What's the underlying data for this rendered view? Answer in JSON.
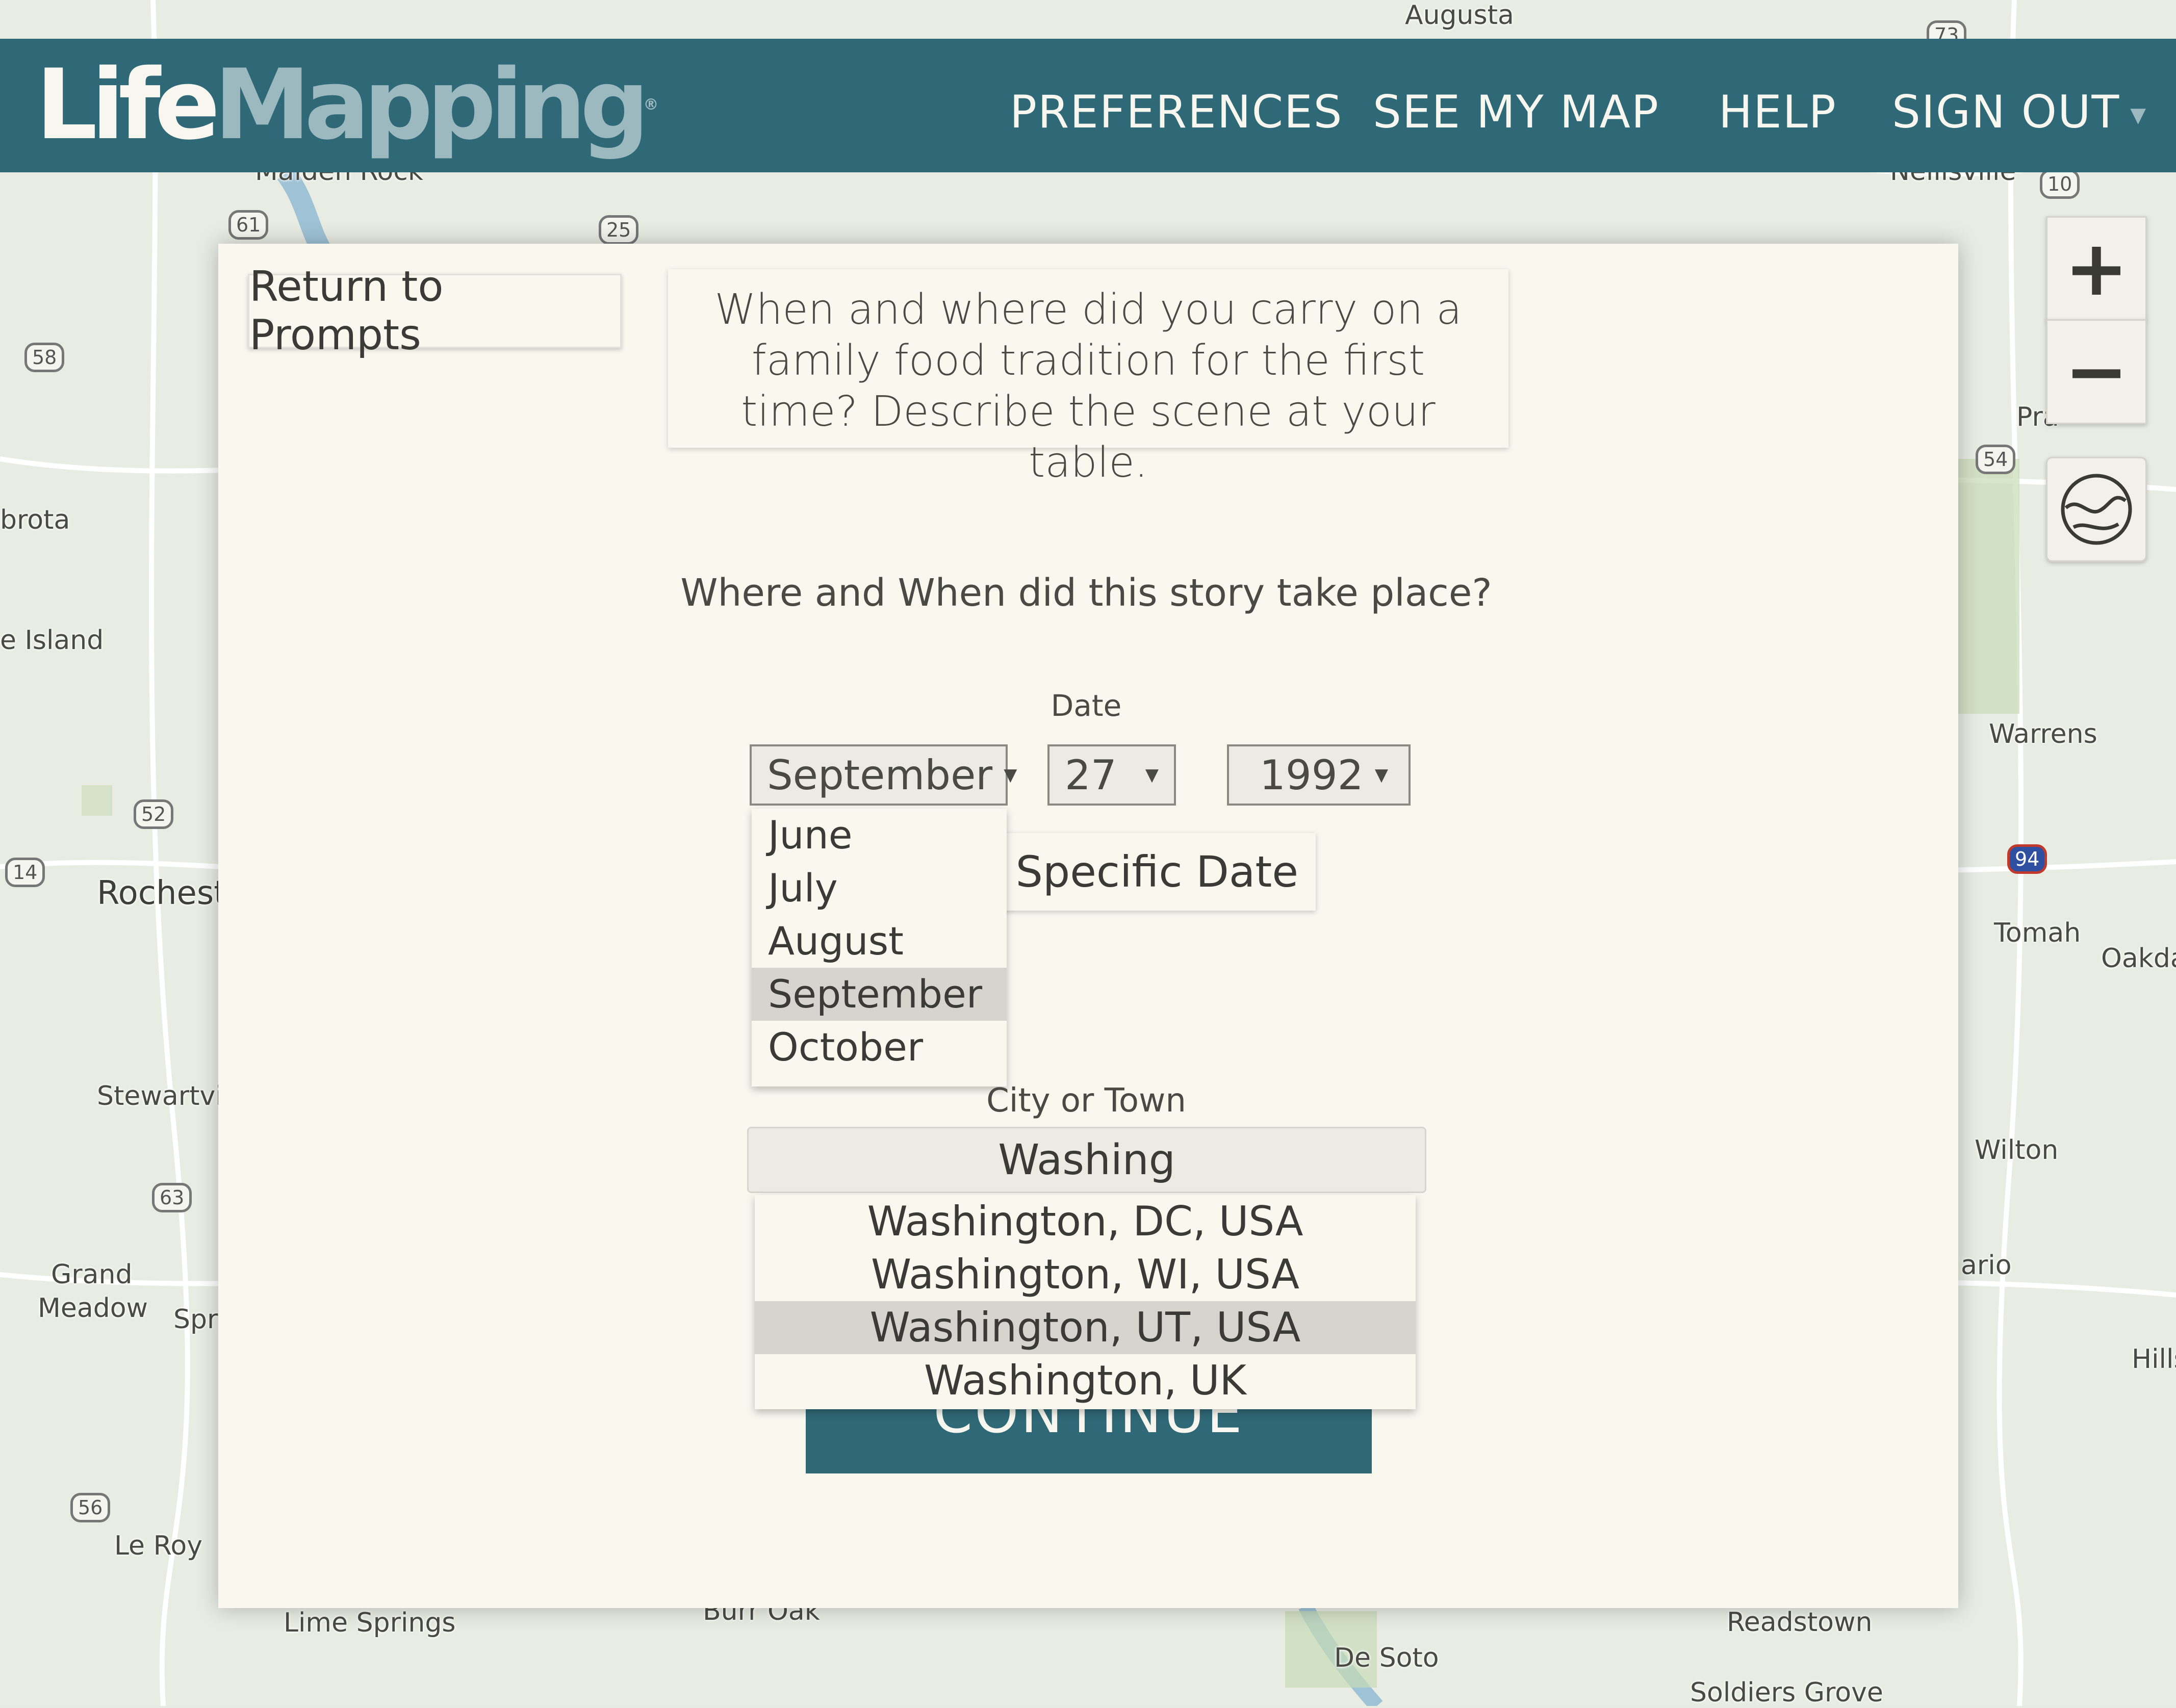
{
  "app": {
    "logo_life": "Life",
    "logo_mapping": "Mapping",
    "logo_mark": "®",
    "brand_color": "#2f6876"
  },
  "nav": {
    "preferences": "PREFERENCES",
    "see_my_map": "SEE MY MAP",
    "help": "HELP",
    "sign_out": "SIGN OUT"
  },
  "map": {
    "labels": [
      "Augusta",
      "Rochest",
      "Stewartvil",
      "Grand",
      "Meadow",
      "Spr",
      "Le Roy",
      "Lime Springs",
      "Burr Oak",
      "De Soto",
      "Readstown",
      "Soldiers Grove",
      "Warrens",
      "Tomah",
      "Oakda",
      "Wilton",
      "ario",
      "Hills",
      "brota",
      "e Island",
      "Pra",
      "Maiden Rock",
      "Nelilsville"
    ],
    "shields": [
      "58",
      "61",
      "25",
      "52",
      "14",
      "63",
      "56",
      "54",
      "94",
      "10",
      "73"
    ],
    "zoom_in": "+",
    "zoom_out": "−"
  },
  "modal": {
    "return_label": "Return to Prompts",
    "prompt_text": "When and where did you carry on a family food tradition for the first time? Describe the scene at your table.",
    "question": "Where and When did this story take place?",
    "date_label": "Date",
    "month_value": "September",
    "day_value": "27",
    "year_value": "1992",
    "no_date_label": "e Specific Date",
    "month_options": [
      "June",
      "July",
      "August",
      "September",
      "October"
    ],
    "city_label": "City or Town",
    "city_value": "Washing",
    "city_options": [
      "Washington, DC, USA",
      "Washington, WI, USA",
      "Washington, UT, USA",
      "Washington, UK"
    ],
    "continue_label": "CONTINUE"
  }
}
